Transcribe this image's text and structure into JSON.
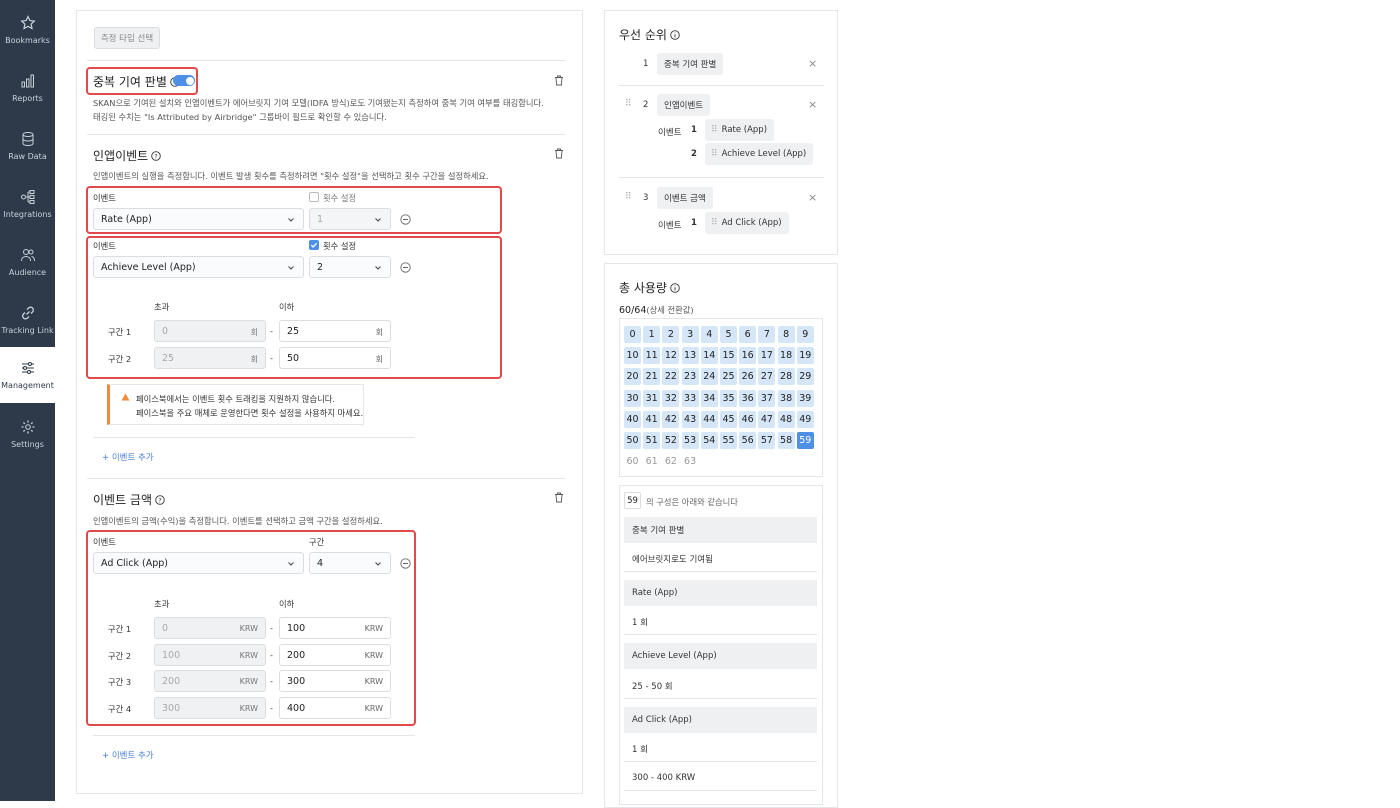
{
  "sidebar": {
    "items": [
      {
        "label": "Bookmarks",
        "icon": "star-icon"
      },
      {
        "label": "Reports",
        "icon": "bar-chart-icon"
      },
      {
        "label": "Raw Data",
        "icon": "database-icon"
      },
      {
        "label": "Integrations",
        "icon": "integrations-icon"
      },
      {
        "label": "Audience",
        "icon": "users-icon"
      },
      {
        "label": "Tracking Link",
        "icon": "link-icon"
      },
      {
        "label": "Management",
        "icon": "sliders-icon"
      },
      {
        "label": "Settings",
        "icon": "gear-icon"
      }
    ]
  },
  "main": {
    "measure_type_button": "측정 타입 선택",
    "dup": {
      "title": "중복 기여 판별",
      "desc1": "SKAN으로 기여된 설치와 인앱이벤트가 에어브릿지 기여 모델(IDFA 방식)로도 기여됐는지 측정하여 중복 기여 여부를 태깅합니다.",
      "desc2": "태깅된 수치는 \"Is Attributed by Airbridge\" 그룹바이 필드로 확인할 수 있습니다."
    },
    "inapp": {
      "title": "인앱이벤트",
      "desc": "인앱이벤트의 실행을 측정합니다. 이벤트 발생 횟수를 측정하려면 \"횟수 설정\"을 선택하고 횟수 구간을 설정하세요.",
      "event_label": "이벤트",
      "count_label": "횟수 설정",
      "row1_event": "Rate (App)",
      "row1_count": "1",
      "row2_event": "Achieve Level (App)",
      "row2_count": "2",
      "over_label": "초과",
      "under_label": "이하",
      "range1_label": "구간 1",
      "range2_label": "구간 2",
      "range1_from": "0",
      "range1_to": "25",
      "range2_from": "25",
      "range2_to": "50",
      "unit": "회",
      "dash": "-",
      "warn1": "페이스북에서는 이벤트 횟수 트래킹을 지원하지 않습니다.",
      "warn2": "페이스북을 주요 매체로 운영한다면 횟수 설정을 사용하지 마세요.",
      "add_event": "+ 이벤트 추가"
    },
    "amount": {
      "title": "이벤트 금액",
      "desc": "인앱이벤트의 금액(수익)을 측정합니다. 이벤트를 선택하고 금액 구간을 설정하세요.",
      "event_label": "이벤트",
      "range_label": "구간",
      "event": "Ad Click (App)",
      "range_count": "4",
      "over_label": "초과",
      "under_label": "이하",
      "unit": "KRW",
      "rows": [
        {
          "label": "구간 1",
          "from": "0",
          "to": "100"
        },
        {
          "label": "구간 2",
          "from": "100",
          "to": "200"
        },
        {
          "label": "구간 3",
          "from": "200",
          "to": "300"
        },
        {
          "label": "구간 4",
          "from": "300",
          "to": "400"
        }
      ],
      "add_event": "+ 이벤트 추가"
    }
  },
  "priority": {
    "title": "우선 순위",
    "items": [
      {
        "num": "1",
        "label": "중복 기여 판별"
      },
      {
        "num": "2",
        "label": "인앱이벤트"
      },
      {
        "num": "3",
        "label": "이벤트 금액"
      }
    ],
    "event_word": "이벤트",
    "item2_events": [
      {
        "num": "1",
        "label": "Rate (App)"
      },
      {
        "num": "2",
        "label": "Achieve Level (App)"
      }
    ],
    "item3_events": [
      {
        "num": "1",
        "label": "Ad Click (App)"
      }
    ]
  },
  "usage": {
    "title": "총 사용량",
    "count": "60/64",
    "count_note": "(상세 전환값)",
    "grid": [
      "0",
      "1",
      "2",
      "3",
      "4",
      "5",
      "6",
      "7",
      "8",
      "9",
      "10",
      "11",
      "12",
      "13",
      "14",
      "15",
      "16",
      "17",
      "18",
      "19",
      "20",
      "21",
      "22",
      "23",
      "24",
      "25",
      "26",
      "27",
      "28",
      "29",
      "30",
      "31",
      "32",
      "33",
      "34",
      "35",
      "36",
      "37",
      "38",
      "39",
      "40",
      "41",
      "42",
      "43",
      "44",
      "45",
      "46",
      "47",
      "48",
      "49",
      "50",
      "51",
      "52",
      "53",
      "54",
      "55",
      "56",
      "57",
      "58",
      "59",
      "60",
      "61",
      "62",
      "63"
    ],
    "selected_value": "59",
    "config_suffix": "의 구성은 아래와 같습니다",
    "config": [
      {
        "head": "중복 기여 판별",
        "vals": [
          "에어브릿지로도 기여됨"
        ]
      },
      {
        "head": "Rate (App)",
        "vals": [
          "1 회"
        ]
      },
      {
        "head": "Achieve Level (App)",
        "vals": [
          "25 - 50 회"
        ]
      },
      {
        "head": "Ad Click (App)",
        "vals": [
          "1 회",
          "300 - 400 KRW"
        ]
      }
    ]
  },
  "colors": {
    "accent": "#4d90e6",
    "highlight": "#e04a4a",
    "sidebar": "#2e3a4a",
    "warning": "#f08a3c"
  }
}
